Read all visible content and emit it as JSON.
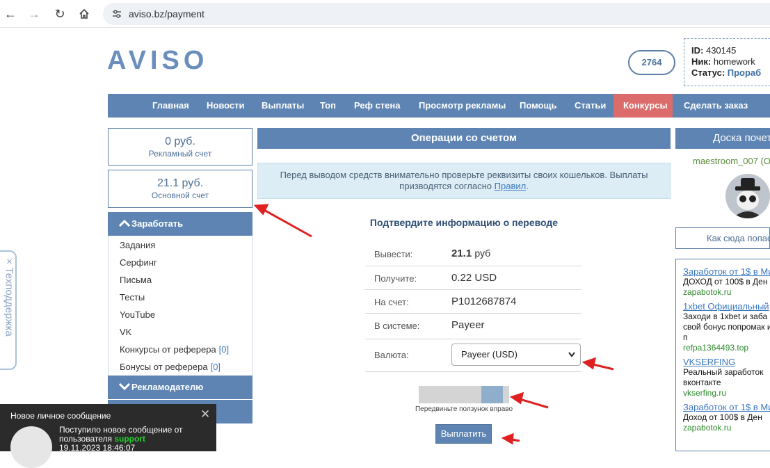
{
  "browser": {
    "url": "aviso.bz/payment"
  },
  "header": {
    "logo": "AVISO",
    "balance_pill": "2764",
    "user": {
      "id_label": "ID:",
      "id_value": "430145",
      "nick_label": "Ник:",
      "nick_value": "homework",
      "status_label": "Статус:",
      "status_value": "Прораб"
    }
  },
  "menu": {
    "items": [
      "Главная",
      "Новости",
      "Выплаты",
      "Топ",
      "Реф стена",
      "Просмотр рекламы",
      "Помощь",
      "Статьи",
      "Конкурсы",
      "Сделать заказ"
    ]
  },
  "sidebar": {
    "ad_account": {
      "amount": "0 руб.",
      "label": "Рекламный счет"
    },
    "main_account": {
      "amount": "21.1 руб.",
      "label": "Основной счет"
    },
    "earn_header": "Заработать",
    "earn_items": [
      {
        "label": "Задания"
      },
      {
        "label": "Серфинг"
      },
      {
        "label": "Письма"
      },
      {
        "label": "Тесты"
      },
      {
        "label": "YouTube"
      },
      {
        "label": "VK"
      },
      {
        "label": "Конкурсы от реферера",
        "count": "[0]"
      },
      {
        "label": "Бонусы от реферера",
        "count": "[0]"
      }
    ],
    "advertiser_header": "Рекламодателю"
  },
  "main": {
    "title": "Операции со счетом",
    "notice_text": "Перед выводом средств внимательно проверьте реквизиты своих кошельков. Выплаты призводятся согласно",
    "notice_link": "Правил",
    "notice_end": ".",
    "confirm_heading": "Подтвердите информацию о переводе",
    "rows": [
      {
        "key": "Вывести:",
        "value": "21.1",
        "unit": "руб"
      },
      {
        "key": "Получите:",
        "value": "0.22 USD"
      },
      {
        "key": "На счет:",
        "value": "P1012687874"
      },
      {
        "key": "В системе:",
        "value": "Payeer"
      },
      {
        "key": "Валюта:",
        "value": "Payeer (USD)"
      }
    ],
    "slider_label": "Передвиньте ползунок вправо",
    "slider_progress": 0.85,
    "pay_button": "Выплатить"
  },
  "right": {
    "header": "Доска почета",
    "name": "maestroom_007 (О",
    "how_button": "Как сюда попасть",
    "ads": [
      {
        "title": "Заработок от 1$ в Ми",
        "desc": "ДОХОД от 100$ в Ден",
        "url": "zapabotok.ru"
      },
      {
        "title": "1xbet Официальный",
        "desc": "Заходи в 1xbet и заба свой бонус попромак или п",
        "url": "refpa1364493.top"
      },
      {
        "title": "VKSERFING",
        "desc": "Реальный заработок вконтакте",
        "url": "vkserfing.ru"
      },
      {
        "title": "Заработок от 1$ в Ми",
        "desc": "Доход от 100$ в Ден",
        "url": "zapabotok.ru"
      }
    ]
  },
  "support_tab": "Техподдержка",
  "notification": {
    "title": "Новое личное сообщение",
    "text": "Поступило новое сообщение от пользователя",
    "sender": "support",
    "time": "19.11.2023 18:46:07"
  },
  "colors": {
    "accent": "#5d84b3",
    "contest": "#dc6b6b",
    "annotation_arrow": "#e02020"
  }
}
